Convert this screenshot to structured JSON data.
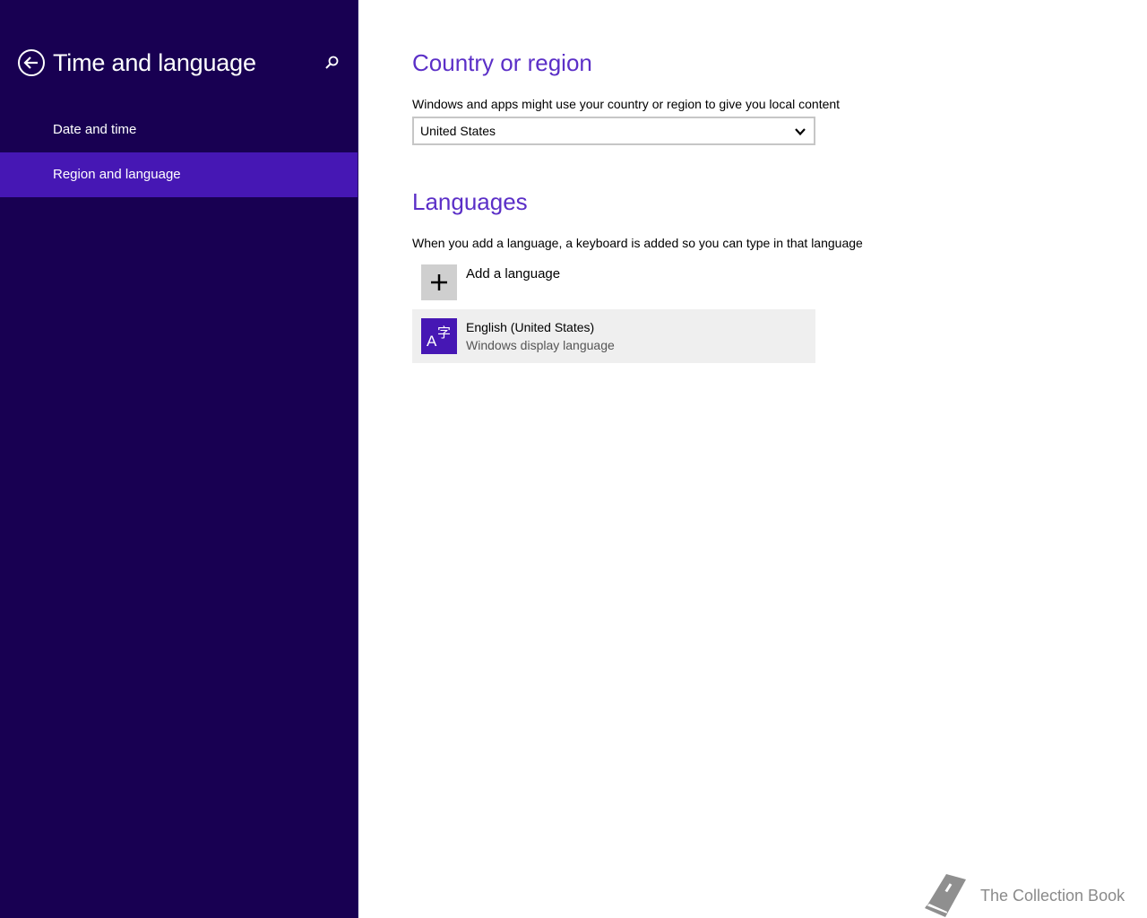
{
  "sidebar": {
    "title": "Time and language",
    "back_icon": "back-arrow-icon",
    "search_icon": "search-icon",
    "items": [
      {
        "label": "Date and time",
        "selected": false
      },
      {
        "label": "Region and language",
        "selected": true
      }
    ]
  },
  "country_section": {
    "title": "Country or region",
    "description": "Windows and apps might use your country or region to give you local content",
    "selected_country": "United States"
  },
  "languages_section": {
    "title": "Languages",
    "description": "When you add a language, a keyboard is added so you can type in that language",
    "add_label": "Add a language",
    "languages": [
      {
        "name": "English (United States)",
        "subtitle": "Windows display language",
        "icon": "language-icon"
      }
    ]
  },
  "watermark": {
    "text": "The Collection Book",
    "icon": "book-icon"
  },
  "colors": {
    "sidebar_bg": "#180052",
    "sidebar_selected": "#4617b4",
    "accent": "#5b2fc7",
    "language_tile": "#4617b4"
  }
}
